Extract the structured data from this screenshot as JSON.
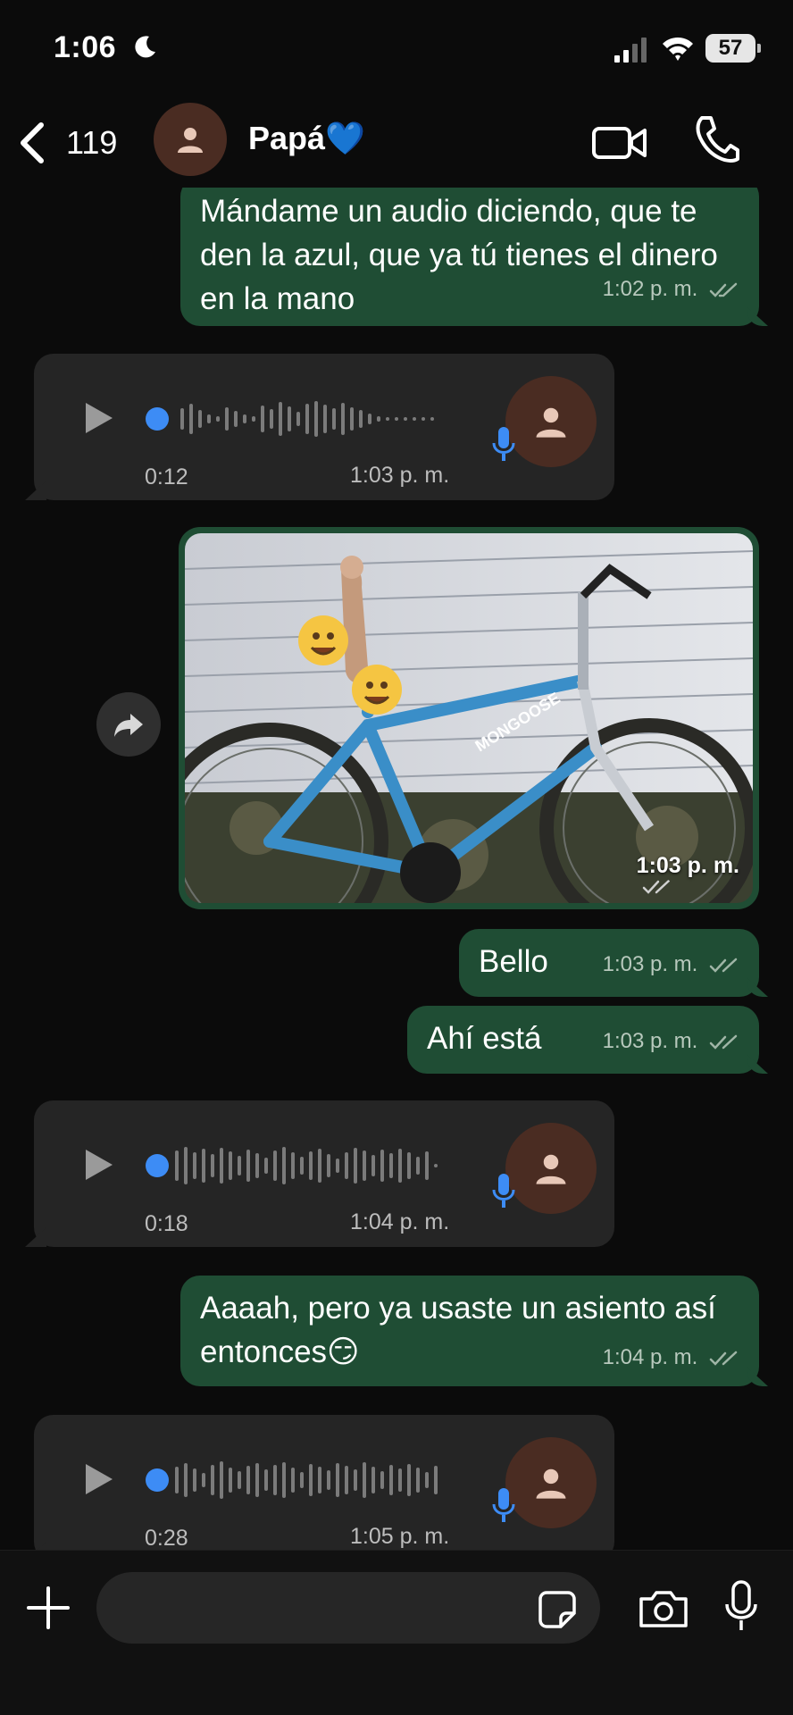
{
  "status_bar": {
    "time": "1:06",
    "battery": "57"
  },
  "header": {
    "back_count": "119",
    "contact_name": "Papá",
    "contact_emoji": "💙"
  },
  "messages": [
    {
      "type": "text",
      "direction": "outgoing",
      "text": "Mándame un audio diciendo, que te den la azul, que ya tú tienes el dinero en la mano",
      "time": "1:02 p. m."
    },
    {
      "type": "voice",
      "direction": "incoming",
      "duration": "0:12",
      "time": "1:03 p. m."
    },
    {
      "type": "image",
      "direction": "outgoing",
      "time": "1:03 p. m.",
      "image_text": "MONGOOSE"
    },
    {
      "type": "text",
      "direction": "outgoing",
      "text": "Bello",
      "time": "1:03 p. m."
    },
    {
      "type": "text",
      "direction": "outgoing",
      "text": "Ahí está",
      "time": "1:03 p. m."
    },
    {
      "type": "voice",
      "direction": "incoming",
      "duration": "0:18",
      "time": "1:04 p. m."
    },
    {
      "type": "text",
      "direction": "outgoing",
      "text": "Aaaah, pero ya usaste un asiento así entonces😏",
      "time": "1:04 p. m."
    },
    {
      "type": "voice",
      "direction": "incoming",
      "duration": "0:28",
      "time": "1:05 p. m."
    }
  ],
  "input": {
    "placeholder": ""
  },
  "colors": {
    "outgoing_bubble": "#1f4d34",
    "incoming_bubble": "#252525",
    "accent_blue": "#3d8cf5",
    "background": "#0b0b0b"
  },
  "icons": [
    "moon-icon",
    "signal-icon",
    "wifi-icon",
    "back-chevron-icon",
    "person-icon",
    "video-call-icon",
    "phone-icon",
    "play-icon",
    "mic-icon",
    "read-ticks-icon",
    "forward-icon",
    "plus-icon",
    "sticker-icon",
    "camera-icon"
  ]
}
